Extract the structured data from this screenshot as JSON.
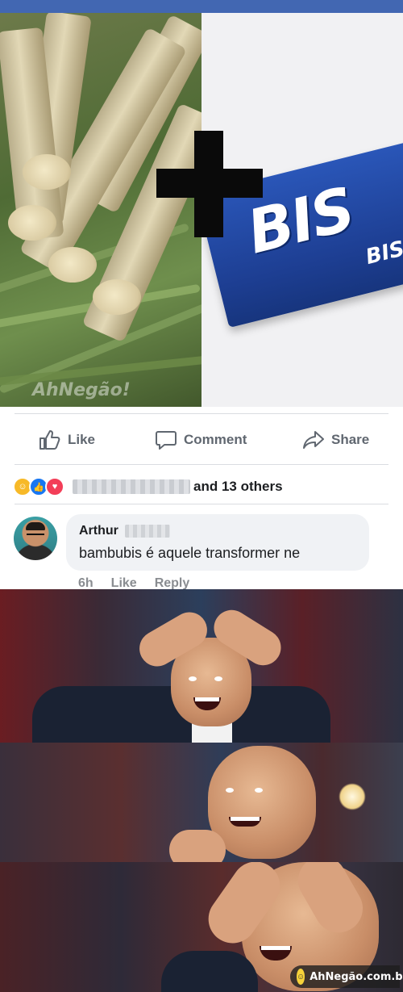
{
  "post_image": {
    "product_name": "BIS",
    "watermark": "AhNegão!"
  },
  "actions": {
    "like": "Like",
    "comment": "Comment",
    "share": "Share"
  },
  "reactions": {
    "types": [
      "haha",
      "like",
      "love"
    ],
    "others_text": "and 13 others"
  },
  "comment": {
    "author_first_name": "Arthur",
    "text": "bambubis é aquele transformer ne",
    "time": "6h",
    "like": "Like",
    "reply": "Reply"
  },
  "watermark": {
    "text": "AhNegão.com.br"
  },
  "colors": {
    "facebook_blue": "#4267b2",
    "action_gray": "#606770",
    "bubble_bg": "#f0f2f5",
    "bis_blue": "#2a56b8"
  }
}
